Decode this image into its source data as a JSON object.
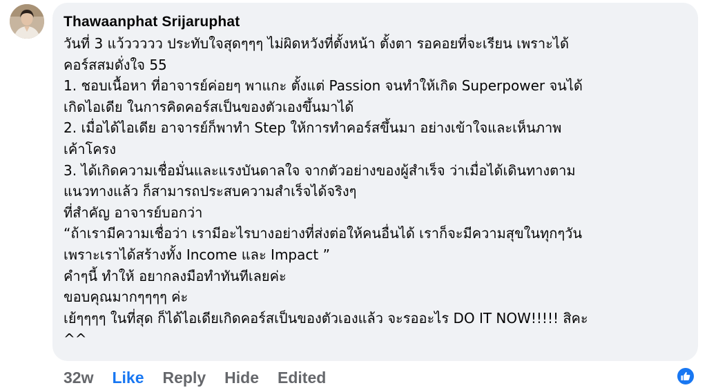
{
  "comment": {
    "author": "Thawaanphat Srijaruphat",
    "lines": [
      "วันที่ 3 แว้ววววว ประทับใจสุดๆๆๆ ไม่ผิดหวังที่ตั้งหน้า ตั้งตา รอคอยที่จะเรียน เพราะได้",
      "คอร์สสมดั่งใจ 55",
      "1. ชอบเนื้อหา ที่อาจารย์ค่อยๆ พาแกะ ตั้งแต่ Passion จนทำให้เกิด Superpower จนได้",
      "เกิดไอเดีย ในการคิดคอร์สเป็นของตัวเองขึ้นมาได้",
      "2. เมื่อได้ไอเดีย อาจารย์ก็พาทำ Step ให้การทำคอร์สขึ้นมา อย่างเข้าใจและเห็นภาพ",
      "เค้าโครง",
      "3. ได้เกิดความเชื่อมั่นและแรงบันดาลใจ จากตัวอย่างของผู้สำเร็จ ว่าเมื่อได้เดินทางตาม",
      "แนวทางแล้ว ก็สามารถประสบความสำเร็จได้จริงๆ",
      "ที่สำคัญ อาจารย์บอกว่า",
      "“ถ้าเรามีความเชื่อว่า เรามีอะไรบางอย่างที่ส่งต่อให้คนอื่นได้ เราก็จะมีความสุขในทุกๆวัน",
      "เพราะเราได้สร้างทั้ง Income และ Impact ”",
      "คำๆนี้ ทำให้ อยากลงมือทำทันทีเลยค่ะ",
      "ขอบคุณมากๆๆๆๆ ค่ะ",
      "เย้ๆๆๆๆ ในที่สุด ก็ได้ไอเดียเกิดคอร์สเป็นของตัวเองแล้ว จะรออะไร DO IT NOW!!!!! สิคะ",
      "^^"
    ]
  },
  "actions": {
    "time": "32w",
    "like": "Like",
    "reply": "Reply",
    "hide": "Hide",
    "edited": "Edited"
  },
  "reaction_icon": "thumbs-up-icon",
  "colors": {
    "accent": "#1877f2",
    "bubble": "#f0f2f5",
    "muted": "#65676b"
  }
}
